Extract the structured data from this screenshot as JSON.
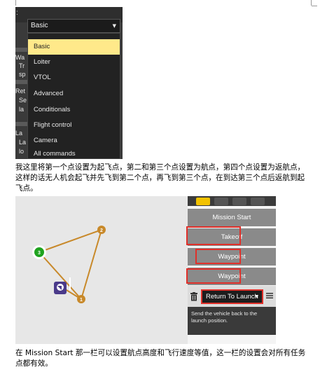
{
  "dropdown_screenshot": {
    "header_colon": ":",
    "background_labels": [
      "Wa",
      "Tr",
      "sp",
      "Ret",
      "Se",
      "la",
      "La",
      "La",
      "lo"
    ],
    "selected_value": "Basic",
    "options": [
      "Basic",
      "Loiter",
      "VTOL",
      "Advanced",
      "Conditionals",
      "Flight control",
      "Camera",
      "All commands"
    ],
    "highlighted_option": "Basic",
    "colors": {
      "highlight": "#ffe98a",
      "menu_bg": "#222222"
    }
  },
  "paragraph_1": "我这里将第一个点设置为起飞点，第二和第三个点设置为航点，第四个点设置为返航点，这样的话无人机会起飞并先飞到第二个点，再飞到第三个点，在到达第三个点后返航到起飞点。",
  "mission_screenshot": {
    "map_markers": [
      {
        "label": "1"
      },
      {
        "label": "2"
      },
      {
        "label": "3"
      }
    ],
    "panel_items": [
      "Mission Start",
      "Takeoff",
      "Waypoint",
      "Waypoint"
    ],
    "command_select": "Return To Launch",
    "command_description": "Send the vehicle back to the launch position.",
    "colors": {
      "highlight_box": "#e0302a",
      "path": "#c8892a",
      "home": "#1fa31f",
      "tab_active": "#f2c200"
    }
  },
  "paragraph_2": "在 Mission Start 那一栏可以设置航点高度和飞行速度等值，这一栏的设置会对所有任务点都有效。"
}
